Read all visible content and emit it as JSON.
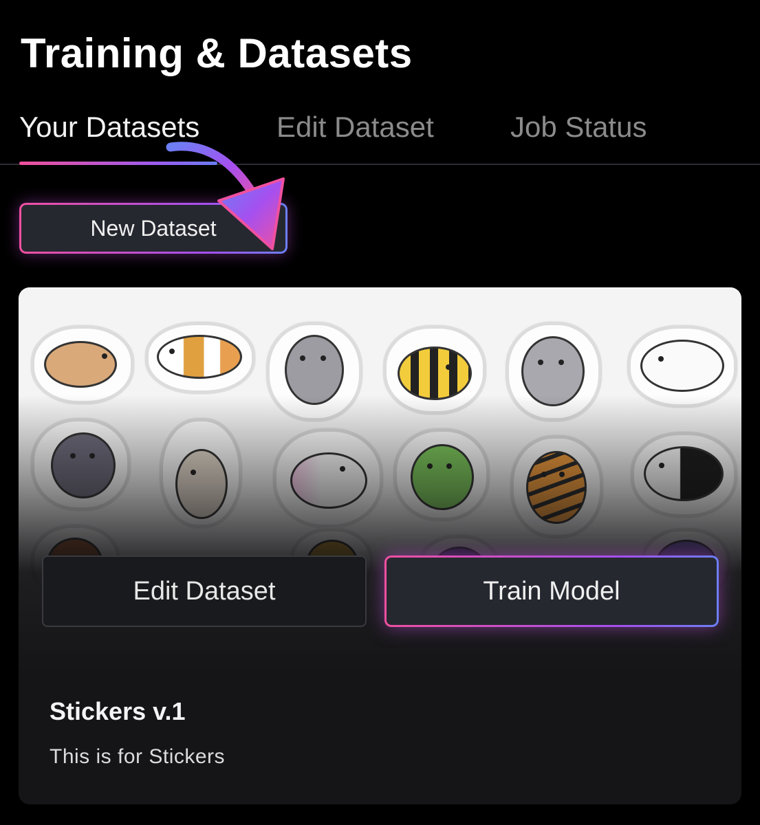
{
  "page": {
    "title": "Training & Datasets"
  },
  "tabs": [
    {
      "label": "Your Datasets",
      "active": true
    },
    {
      "label": "Edit Dataset",
      "active": false
    },
    {
      "label": "Job Status",
      "active": false
    }
  ],
  "actions": {
    "new_dataset_label": "New Dataset"
  },
  "dataset_card": {
    "name": "Stickers v.1",
    "description": "This is for Stickers",
    "edit_button_label": "Edit Dataset",
    "train_button_label": "Train Model"
  },
  "colors": {
    "background": "#000000",
    "accent_start": "#f050a0",
    "accent_mid": "#a550f0",
    "accent_end": "#6c7ff5",
    "inactive_tab": "#8b8b8b"
  }
}
